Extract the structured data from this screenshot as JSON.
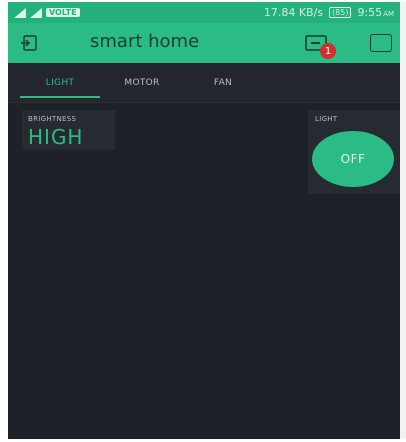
{
  "status_bar": {
    "volte": "VOLTE",
    "speed": "17.84 KB/s",
    "battery": "(85)",
    "time": "9:55",
    "ampm": "AM"
  },
  "app_bar": {
    "title": "smart home",
    "notification_count": "1"
  },
  "tabs": [
    {
      "label": "LIGHT",
      "active": true
    },
    {
      "label": "MOTOR",
      "active": false
    },
    {
      "label": "FAN",
      "active": false
    }
  ],
  "widgets": {
    "brightness": {
      "label": "BRIGHTNESS",
      "value": "HIGH"
    },
    "light": {
      "label": "LIGHT",
      "button_label": "OFF"
    }
  },
  "colors": {
    "accent": "#2bbb85",
    "background": "#1e2127",
    "widget": "#262a31",
    "badge": "#d32f2f"
  }
}
